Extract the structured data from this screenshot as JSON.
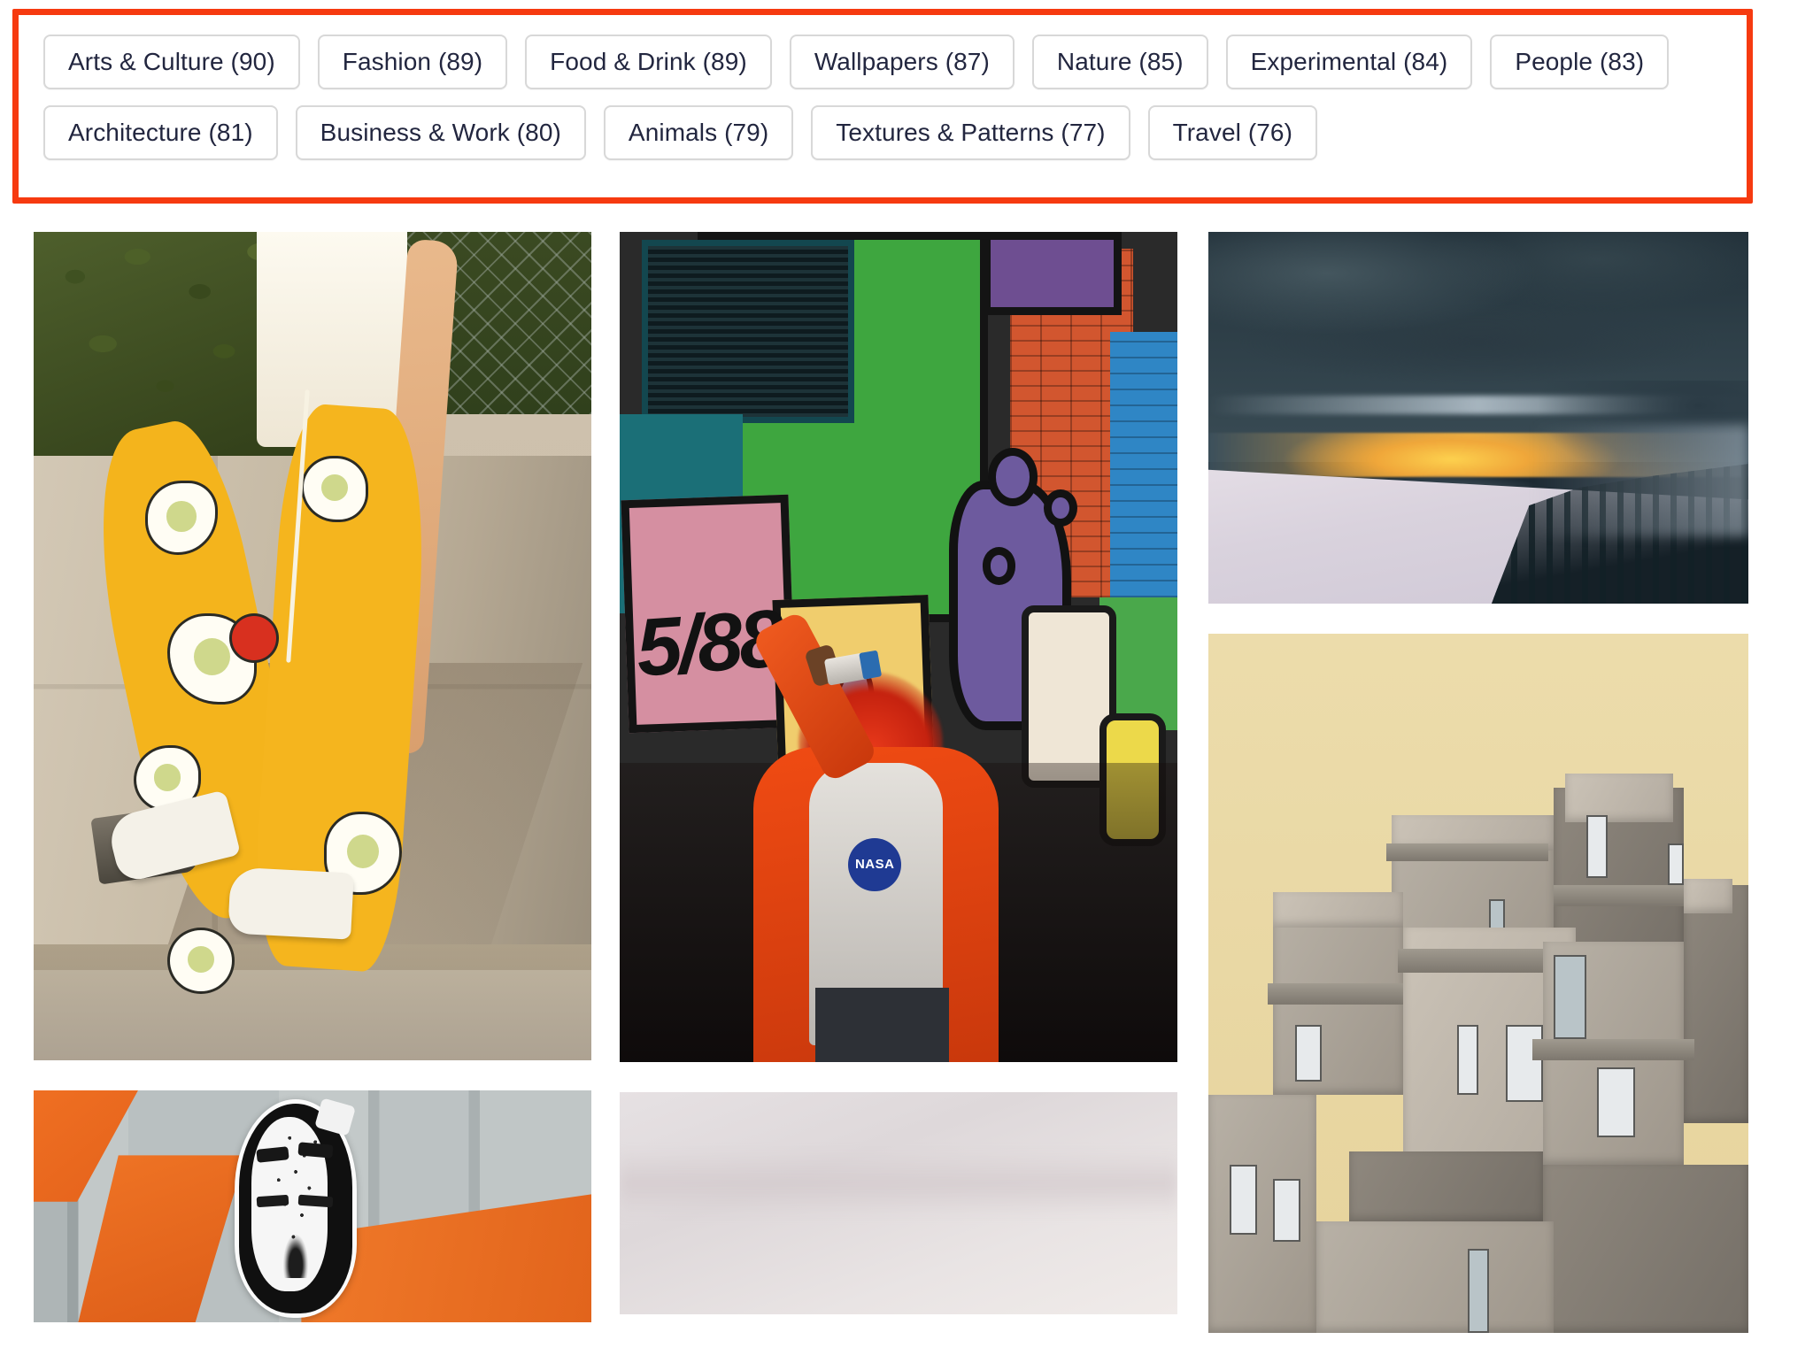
{
  "tag_filter": {
    "highlight_color": "#f63a10",
    "chip_border_color": "#d8d8d8",
    "chip_text_color": "#22263f",
    "tags": [
      {
        "label": "Arts & Culture (90)",
        "name": "Arts & Culture",
        "count": 90
      },
      {
        "label": "Fashion (89)",
        "name": "Fashion",
        "count": 89
      },
      {
        "label": "Food & Drink (89)",
        "name": "Food & Drink",
        "count": 89
      },
      {
        "label": "Wallpapers (87)",
        "name": "Wallpapers",
        "count": 87
      },
      {
        "label": "Nature (85)",
        "name": "Nature",
        "count": 85
      },
      {
        "label": "Experimental (84)",
        "name": "Experimental",
        "count": 84
      },
      {
        "label": "People (83)",
        "name": "People",
        "count": 83
      },
      {
        "label": "Architecture (81)",
        "name": "Architecture",
        "count": 81
      },
      {
        "label": "Business & Work (80)",
        "name": "Business & Work",
        "count": 80
      },
      {
        "label": "Animals (79)",
        "name": "Animals",
        "count": 79
      },
      {
        "label": "Textures & Patterns (77)",
        "name": "Textures & Patterns",
        "count": 77
      },
      {
        "label": "Travel (76)",
        "name": "Travel",
        "count": 76
      }
    ]
  },
  "gallery": {
    "columns": [
      {
        "id": "column-1",
        "photos": [
          {
            "id": "photo-yellow-egg-print-pants",
            "alt": "Person in yellow egg-print pants leaning on concrete wall"
          },
          {
            "id": "photo-graffiti-face-sticker",
            "alt": "Black and white stippled face sticker on orange painted wall"
          }
        ]
      },
      {
        "id": "column-2",
        "photos": [
          {
            "id": "photo-graffiti-wall-portrait",
            "alt": "Person in orange puffer jacket and NASA hoodie in front of colorful graffiti wall",
            "graffiti_tag_text": "5/88",
            "hoodie_badge": "NASA"
          },
          {
            "id": "photo-pale-abstract",
            "alt": "Pale minimal abstract gradient"
          }
        ]
      },
      {
        "id": "column-3",
        "photos": [
          {
            "id": "photo-snowy-sunset-landscape",
            "alt": "Snowy mountain slope with pine forest under dark clouds and golden sunset"
          },
          {
            "id": "photo-brutalist-architecture",
            "alt": "Brutalist concrete modular apartment building against warm beige sky"
          }
        ]
      }
    ]
  }
}
